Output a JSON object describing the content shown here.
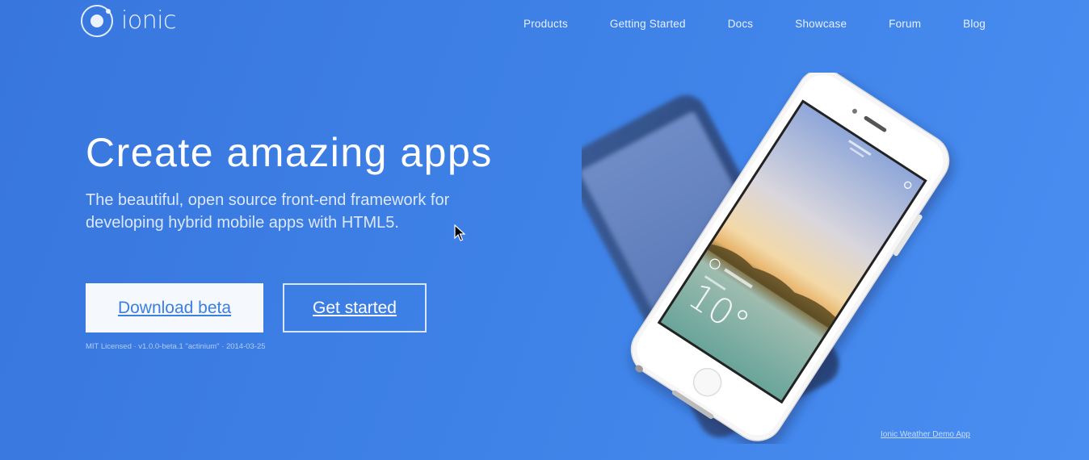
{
  "brand": {
    "name": "ionic"
  },
  "nav": {
    "items": [
      "Products",
      "Getting Started",
      "Docs",
      "Showcase",
      "Forum",
      "Blog"
    ]
  },
  "hero": {
    "headline": "Create amazing apps",
    "subhead": "The beautiful, open source front-end framework for developing hybrid mobile apps with HTML5.",
    "primary_button": "Download beta",
    "secondary_button": "Get started",
    "meta": "MIT Licensed · v1.0.0-beta.1 \"actinium\" · 2014-03-25"
  },
  "phone_screen": {
    "temperature": "10°"
  },
  "demo_link": "Ionic Weather Demo App",
  "colors": {
    "background": "#3f83e8",
    "button_text": "#3a7fe4",
    "phone_body": "#f4f4f4",
    "back_phone": "#2d4d85"
  },
  "icons": [
    "ionic-logo-icon",
    "mouse-cursor-icon",
    "settings-gear-icon",
    "weather-icon"
  ]
}
